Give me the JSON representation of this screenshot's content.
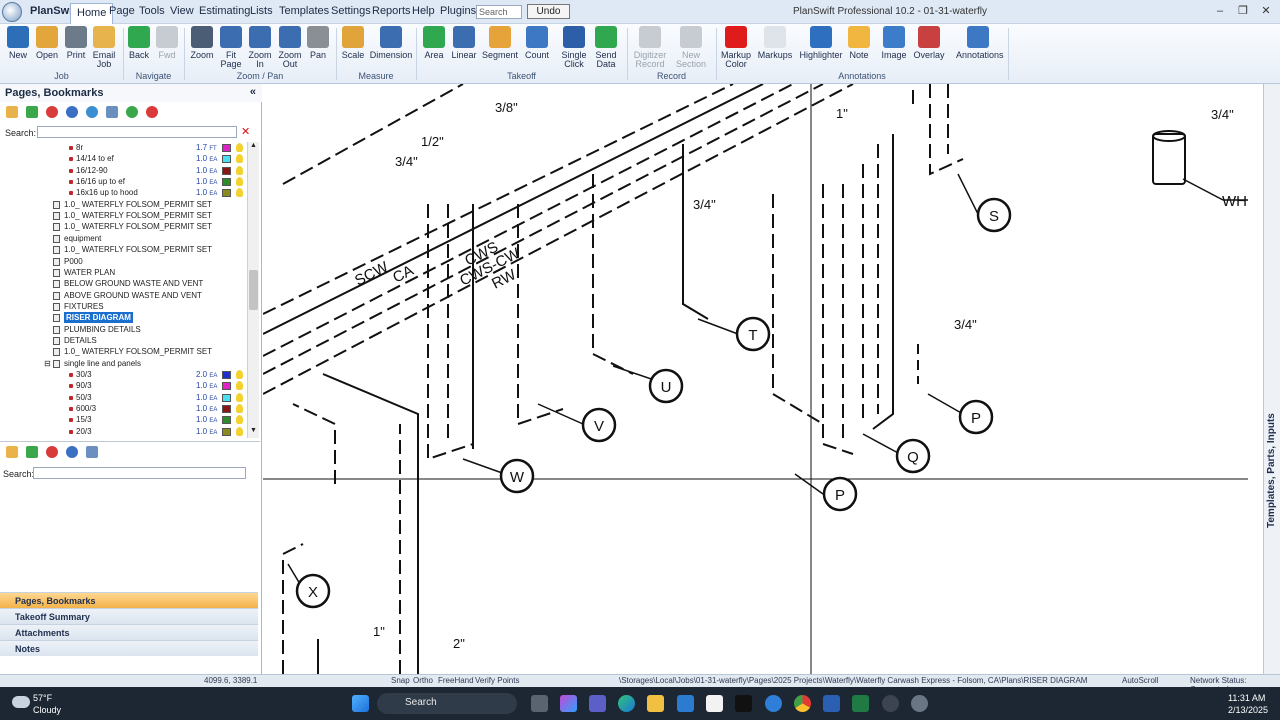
{
  "app": {
    "title": "PlanSwift Professional 10.2 - 01-31-waterfly",
    "app_label": "PlanSwift",
    "menus": [
      "Home",
      "Page",
      "Tools",
      "View",
      "Estimating",
      "Lists",
      "Templates",
      "Settings",
      "Reports",
      "Help",
      "Plugins"
    ],
    "active_menu": "Home",
    "search_placeholder": "Search",
    "undo_label": "Undo",
    "window_controls": [
      "–",
      "❐",
      "✕"
    ]
  },
  "ribbon": {
    "buttons": [
      {
        "label": "New",
        "icon": "new-icon",
        "color": "#2c6fb8"
      },
      {
        "label": "Open",
        "icon": "open-folder-icon",
        "color": "#e3a63a"
      },
      {
        "label": "Print",
        "icon": "print-icon",
        "color": "#6c7a8a"
      },
      {
        "label": "Email\nJob",
        "icon": "email-icon",
        "color": "#e6b34d"
      },
      {
        "label": "Back",
        "icon": "back-arrow-icon",
        "color": "#2fa84f"
      },
      {
        "label": "Fwd",
        "icon": "forward-arrow-icon",
        "color": "#c7ccd2",
        "disabled": true
      },
      {
        "label": "Zoom",
        "icon": "zoom-icon",
        "color": "#4a5d75"
      },
      {
        "label": "Fit\nPage",
        "icon": "fit-page-icon",
        "color": "#3c6db0"
      },
      {
        "label": "Zoom\nIn",
        "icon": "zoom-in-icon",
        "color": "#3c6db0"
      },
      {
        "label": "Zoom\nOut",
        "icon": "zoom-out-icon",
        "color": "#3c6db0"
      },
      {
        "label": "Pan",
        "icon": "pan-hand-icon",
        "color": "#8a8f96"
      },
      {
        "label": "Scale",
        "icon": "scale-icon",
        "color": "#e0a43a"
      },
      {
        "label": "Dimension",
        "icon": "dimension-icon",
        "color": "#3c6db0"
      },
      {
        "label": "Area",
        "icon": "area-icon",
        "color": "#2fa84f"
      },
      {
        "label": "Linear",
        "icon": "linear-icon",
        "color": "#3c6db0"
      },
      {
        "label": "Segment",
        "icon": "segment-icon",
        "color": "#e6a33a"
      },
      {
        "label": "Count",
        "icon": "count-icon",
        "color": "#3c78c4"
      },
      {
        "label": "Single\nClick",
        "icon": "single-click-icon",
        "color": "#2d5ea8"
      },
      {
        "label": "Send\nData",
        "icon": "send-data-icon",
        "color": "#2fa84f"
      },
      {
        "label": "Digitizer\nRecord",
        "icon": "digitizer-icon",
        "color": "#c7ccd2",
        "disabled": true
      },
      {
        "label": "New\nSection",
        "icon": "new-section-icon",
        "color": "#c7ccd2",
        "disabled": true
      },
      {
        "label": "Markup\nColor",
        "icon": "markup-color-icon",
        "color": "#e01b1b"
      },
      {
        "label": "Markups",
        "icon": "markups-cloud-icon",
        "color": "#dfe4ea"
      },
      {
        "label": "Highlighter",
        "icon": "highlighter-icon",
        "color": "#2f6fc0"
      },
      {
        "label": "Note",
        "icon": "note-icon",
        "color": "#f0b640"
      },
      {
        "label": "Image",
        "icon": "image-icon",
        "color": "#3d7cc8"
      },
      {
        "label": "Overlay",
        "icon": "overlay-icon",
        "color": "#c84040"
      },
      {
        "label": "Annotations",
        "icon": "annotations-icon",
        "color": "#3c78c4"
      }
    ],
    "groups": [
      "Job",
      "Navigate",
      "Zoom / Pan",
      "Measure",
      "Takeoff",
      "Record",
      "Annotations"
    ]
  },
  "left_pane": {
    "title": "Pages, Bookmarks",
    "collapse": "«",
    "search_label": "Search:",
    "search2_label": "Search:",
    "clear_icon": "✕",
    "tree": [
      {
        "text": "8r",
        "indent": 2,
        "kind": "item",
        "qty": "1.7",
        "unit": "FT",
        "swatch": "#e023c9"
      },
      {
        "text": "14/14 to ef",
        "indent": 2,
        "kind": "item",
        "qty": "1.0",
        "unit": "EA",
        "swatch": "#48e0f0"
      },
      {
        "text": "16/12-90",
        "indent": 2,
        "kind": "item",
        "qty": "1.0",
        "unit": "EA",
        "swatch": "#8a1515"
      },
      {
        "text": "16/16 up to ef",
        "indent": 2,
        "kind": "item",
        "qty": "1.0",
        "unit": "EA",
        "swatch": "#2d8a2d"
      },
      {
        "text": "16x16 up to hood",
        "indent": 2,
        "kind": "item",
        "qty": "1.0",
        "unit": "EA",
        "swatch": "#8a8a1f"
      },
      {
        "text": "1.0_ WATERFLY FOLSOM_PERMIT SET",
        "indent": 1,
        "kind": "page"
      },
      {
        "text": "1.0_ WATERFLY FOLSOM_PERMIT SET",
        "indent": 1,
        "kind": "page"
      },
      {
        "text": "1.0_ WATERFLY FOLSOM_PERMIT SET",
        "indent": 1,
        "kind": "page"
      },
      {
        "text": "equipment",
        "indent": 1,
        "kind": "page"
      },
      {
        "text": "1.0_ WATERFLY FOLSOM_PERMIT SET",
        "indent": 1,
        "kind": "page"
      },
      {
        "text": "P000",
        "indent": 1,
        "kind": "page"
      },
      {
        "text": "WATER PLAN",
        "indent": 1,
        "kind": "page"
      },
      {
        "text": "BELOW GROUND WASTE AND VENT",
        "indent": 1,
        "kind": "page"
      },
      {
        "text": "ABOVE GROUND WASTE AND VENT",
        "indent": 1,
        "kind": "page"
      },
      {
        "text": "FIXTURES",
        "indent": 1,
        "kind": "page"
      },
      {
        "text": "RISER DIAGRAM",
        "indent": 1,
        "kind": "page",
        "selected": true
      },
      {
        "text": "PLUMBING DETAILS",
        "indent": 1,
        "kind": "page"
      },
      {
        "text": "DETAILS",
        "indent": 1,
        "kind": "page"
      },
      {
        "text": "1.0_ WATERFLY FOLSOM_PERMIT SET",
        "indent": 1,
        "kind": "page"
      },
      {
        "text": "single line and panels",
        "indent": 0,
        "kind": "folder"
      },
      {
        "text": "30/3",
        "indent": 2,
        "kind": "item",
        "qty": "2.0",
        "unit": "EA",
        "swatch": "#1f2fd0"
      },
      {
        "text": "90/3",
        "indent": 2,
        "kind": "item",
        "qty": "1.0",
        "unit": "EA",
        "swatch": "#e023c9"
      },
      {
        "text": "50/3",
        "indent": 2,
        "kind": "item",
        "qty": "1.0",
        "unit": "EA",
        "swatch": "#48e0f0"
      },
      {
        "text": "600/3",
        "indent": 2,
        "kind": "item",
        "qty": "1.0",
        "unit": "EA",
        "swatch": "#8a1515"
      },
      {
        "text": "15/3",
        "indent": 2,
        "kind": "item",
        "qty": "1.0",
        "unit": "EA",
        "swatch": "#2d8a2d"
      },
      {
        "text": "20/3",
        "indent": 2,
        "kind": "item",
        "qty": "1.0",
        "unit": "EA",
        "swatch": "#8a8a1f"
      }
    ],
    "accordions": [
      {
        "label": "Pages, Bookmarks",
        "active": true
      },
      {
        "label": "Takeoff Summary"
      },
      {
        "label": "Attachments"
      },
      {
        "label": "Notes"
      }
    ]
  },
  "drawing": {
    "bubbles": [
      "S",
      "T",
      "U",
      "V",
      "W",
      "P",
      "Q",
      "P",
      "X"
    ],
    "pipe_labels": [
      "SCW",
      "CA",
      "CWS",
      "CWS-CW",
      "RW"
    ],
    "sizes": [
      "3/8\"",
      "1/2\"",
      "3/4\"",
      "3/4\"",
      "1\"",
      "3/4\"",
      "3/4\"",
      "1\"",
      "2\""
    ],
    "wh_label": "WH"
  },
  "right_bar": {
    "label": "Templates, Parts, Inputs"
  },
  "status": {
    "coords": "4099.6, 3389.1",
    "snap": "Snap",
    "ortho": "Ortho",
    "freehand": "FreeHand",
    "verify": "Verify Points",
    "path": "\\Storages\\Local\\Jobs\\01-31-waterfly\\Pages\\2025 Projects\\Waterfly\\Waterfly Carwash Express - Folsom, CA\\Plans\\RISER DIAGRAM",
    "autoscroll": "AutoScroll",
    "network": "Network Status: Connected"
  },
  "taskbar": {
    "weather_temp": "57°F",
    "weather_desc": "Cloudy",
    "search": "Search",
    "time": "11:31 AM",
    "date": "2/13/2025"
  }
}
